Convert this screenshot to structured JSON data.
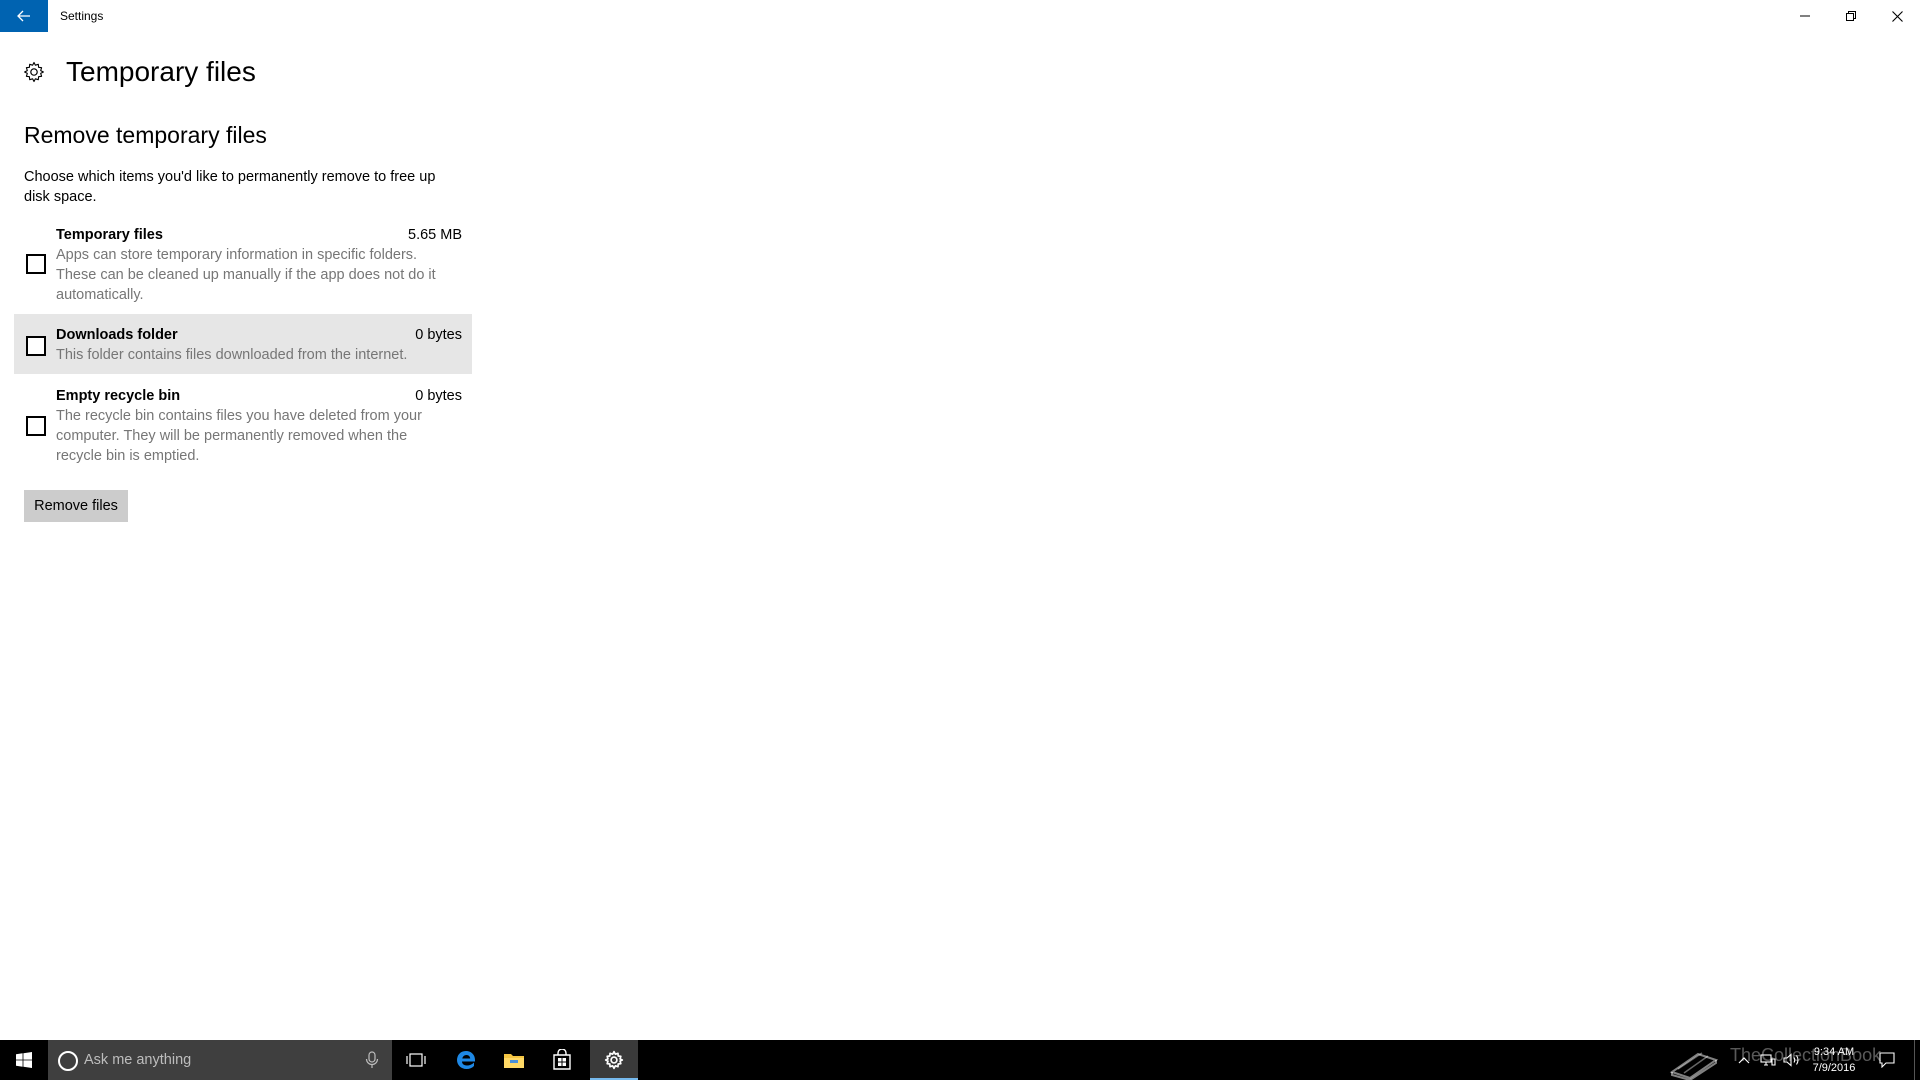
{
  "window": {
    "title": "Settings"
  },
  "page": {
    "title": "Temporary files",
    "section_title": "Remove temporary files",
    "description": "Choose which items you'd like to permanently remove to free up disk space."
  },
  "items": [
    {
      "name": "Temporary files",
      "size": "5.65 MB",
      "description": "Apps can store temporary information in specific folders. These can be cleaned up manually if the app does not do it automatically.",
      "checked": false
    },
    {
      "name": "Downloads folder",
      "size": "0 bytes",
      "description": "This folder contains files downloaded from the internet.",
      "checked": false
    },
    {
      "name": "Empty recycle bin",
      "size": "0 bytes",
      "description": "The recycle bin contains files you have deleted from your computer. They will be permanently removed when the recycle bin is emptied.",
      "checked": false
    }
  ],
  "actions": {
    "remove_label": "Remove files"
  },
  "taskbar": {
    "search_placeholder": "Ask me anything",
    "watermark": "TheCollectionBook",
    "clock_time": "9:34 AM",
    "clock_date": "7/9/2016",
    "icons": [
      "start-icon",
      "cortana-icon",
      "microphone-icon",
      "task-view-icon",
      "edge-icon",
      "file-explorer-icon",
      "store-icon",
      "settings-icon",
      "chevron-up-icon",
      "network-icon",
      "volume-icon",
      "action-center-icon"
    ]
  },
  "colors": {
    "accent": "#0063b1",
    "hover_row": "#e6e6e6",
    "secondary_text": "#767676",
    "button_bg": "#cccccc",
    "taskbar_bg": "#000000",
    "taskbar_active_underline": "#76b9ed"
  }
}
